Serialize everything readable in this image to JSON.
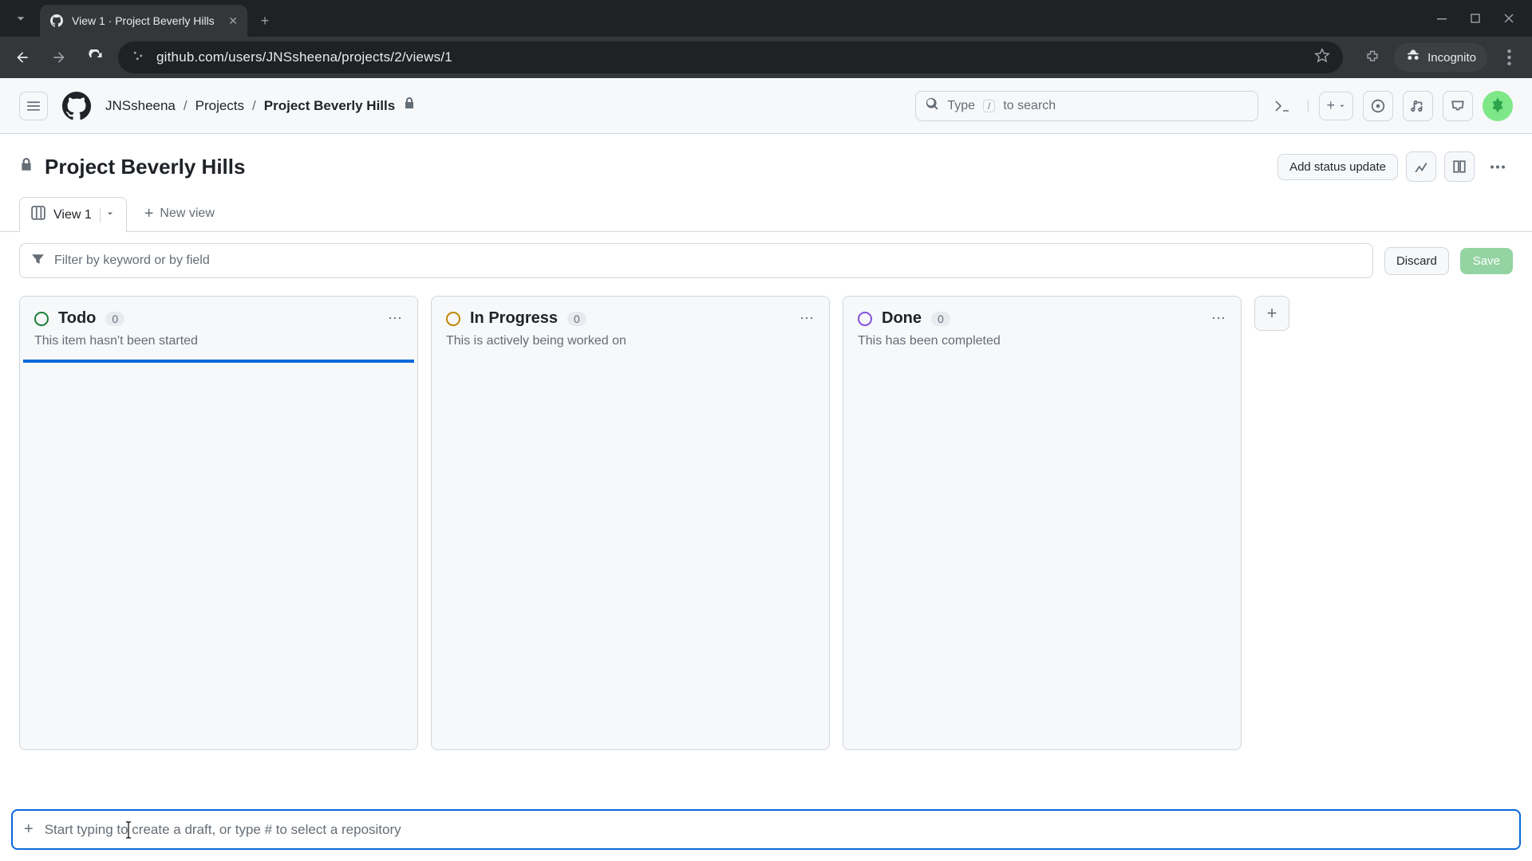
{
  "browser": {
    "tab_title": "View 1 · Project Beverly Hills",
    "url": "github.com/users/JNSsheena/projects/2/views/1",
    "incognito_label": "Incognito"
  },
  "header": {
    "breadcrumbs": {
      "user": "JNSsheena",
      "projects": "Projects",
      "current": "Project Beverly Hills"
    },
    "search_prefix": "Type",
    "search_kbd": "/",
    "search_suffix": "to search"
  },
  "project": {
    "title": "Project Beverly Hills",
    "add_status_label": "Add status update"
  },
  "tabs": {
    "view_label": "View 1",
    "new_view_label": "New view"
  },
  "filter": {
    "placeholder": "Filter by keyword or by field",
    "discard_label": "Discard",
    "save_label": "Save"
  },
  "columns": [
    {
      "name": "Todo",
      "count": "0",
      "desc": "This item hasn't been started",
      "dot": "dot-green",
      "active": true
    },
    {
      "name": "In Progress",
      "count": "0",
      "desc": "This is actively being worked on",
      "dot": "dot-yellow",
      "active": false
    },
    {
      "name": "Done",
      "count": "0",
      "desc": "This has been completed",
      "dot": "dot-purple",
      "active": false
    }
  ],
  "add_item": {
    "placeholder": "Start typing to create a draft, or type # to select a repository"
  }
}
